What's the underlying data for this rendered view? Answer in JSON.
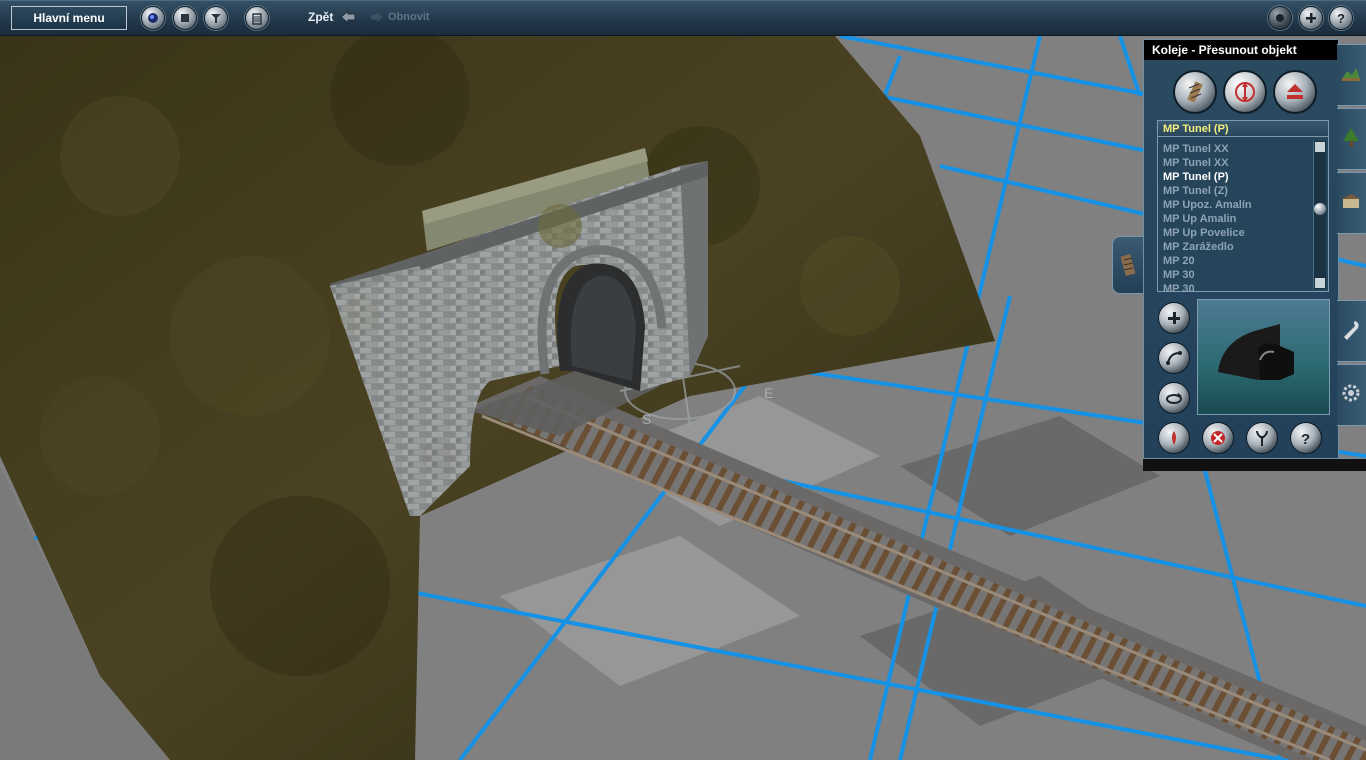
{
  "toolbar": {
    "main_menu_label": "Hlavní menu",
    "undo_label": "Zpět",
    "redo_label": "Obnovit"
  },
  "panel": {
    "title": "Koleje - Přesunout objekt",
    "selected_item": "MP Tunel (P)",
    "items": [
      "MP Tunel XX",
      "MP Tunel XX",
      "MP Tunel (P)",
      "MP Tunel (Z)",
      "MP Upoz. Amalín",
      "MP Up Amalin",
      "MP Up Povelice",
      "MP Zarážedlo",
      "MP 20",
      "MP 30",
      "MP 30"
    ],
    "highlighted_index": 2
  },
  "scene": {
    "compass_east": "E",
    "compass_south": "S"
  },
  "colors": {
    "toolbar": "#22374a",
    "panel": "#26445a",
    "grid_line": "#1592e6",
    "ground": "#7d7d7d",
    "terrain": "#3f3a1c",
    "selected_text": "#f4ee7a"
  }
}
